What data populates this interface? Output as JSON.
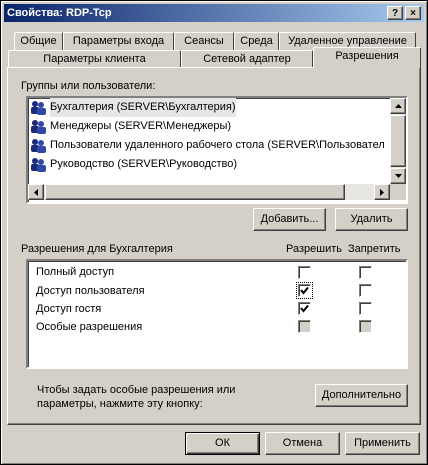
{
  "window": {
    "title": "Свойства: RDP-Tcp",
    "help_label": "?",
    "close_label": "×"
  },
  "tabs_row1": [
    "Общие",
    "Параметры входа",
    "Сеансы",
    "Среда",
    "Удаленное управление"
  ],
  "tabs_row2": [
    "Параметры клиента",
    "Сетевой адаптер",
    "Разрешения"
  ],
  "groups": {
    "label": "Группы или пользователи:",
    "items": [
      "Бухгалтерия (SERVER\\Бухгалтерия)",
      "Менеджеры (SERVER\\Менеджеры)",
      "Пользователи удаленного рабочего стола (SERVER\\Пользовател",
      "Руководство (SERVER\\Руководство)"
    ],
    "selected_index": 0
  },
  "group_buttons": {
    "add": "Добавить...",
    "remove": "Удалить"
  },
  "permissions": {
    "label": "Разрешения для Бухгалтерия",
    "allow_header": "Разрешить",
    "deny_header": "Запретить",
    "rows": [
      {
        "name": "Полный доступ",
        "allow": false,
        "deny": false,
        "allow_disabled": false,
        "deny_disabled": false
      },
      {
        "name": "Доступ пользователя",
        "allow": true,
        "deny": false,
        "allow_disabled": false,
        "deny_disabled": false
      },
      {
        "name": "Доступ гостя",
        "allow": true,
        "deny": false,
        "allow_disabled": false,
        "deny_disabled": false
      },
      {
        "name": "Особые разрешения",
        "allow": false,
        "deny": false,
        "allow_disabled": true,
        "deny_disabled": true
      }
    ]
  },
  "advanced": {
    "hint_line1": "Чтобы задать особые разрешения или",
    "hint_line2": "параметры, нажмите эту кнопку:",
    "button": "Дополнительно"
  },
  "footer": {
    "ok": "ОК",
    "cancel": "Отмена",
    "apply": "Применить"
  }
}
